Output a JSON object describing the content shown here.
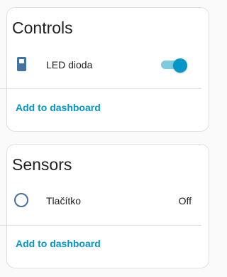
{
  "controls": {
    "title": "Controls",
    "entity": {
      "label": "LED dioda",
      "icon": "remote-icon",
      "toggle_on": true
    },
    "action_label": "Add to dashboard"
  },
  "sensors": {
    "title": "Sensors",
    "entity": {
      "label": "Tlačítko",
      "icon": "circle-outline-icon",
      "state": "Off"
    },
    "action_label": "Add to dashboard"
  },
  "colors": {
    "accent": "#0396c6",
    "icon": "#44739e",
    "toggle_track": "#7ccbe0"
  }
}
